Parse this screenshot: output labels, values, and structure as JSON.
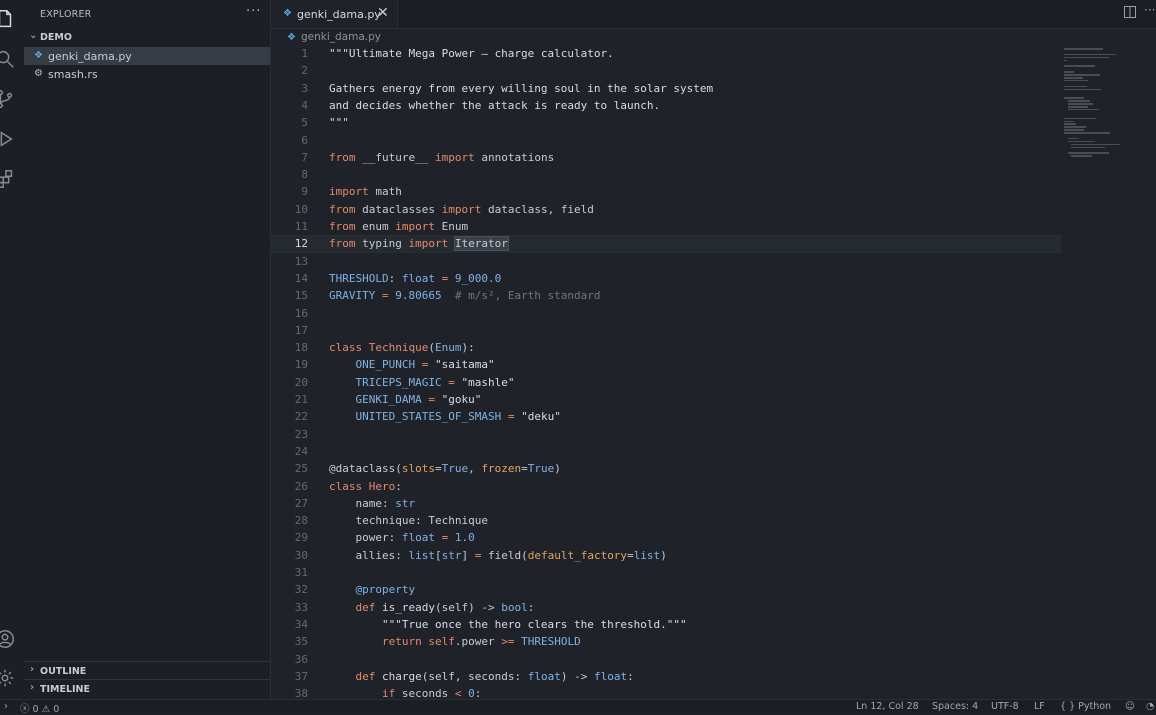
{
  "sidebar": {
    "title": "EXPLORER",
    "more": "···",
    "folder": "DEMO",
    "files": [
      {
        "name": "genki_dama.py",
        "icon": "python-file-icon"
      },
      {
        "name": "smash.rs",
        "icon": "rust-file-icon"
      }
    ],
    "outline": "OUTLINE",
    "timeline": "TIMELINE"
  },
  "tab": {
    "name": "genki_dama.py",
    "close": "✕"
  },
  "tabbar_more": "···",
  "breadcrumb": "genki_dama.py",
  "editor": {
    "current_line": 12,
    "lines": [
      [
        {
          "t": "\"\"\"Ultimate Mega Power — charge calculator.",
          "c": "str"
        }
      ],
      [],
      [
        {
          "t": "Gathers energy from every willing soul in the solar system",
          "c": "str"
        }
      ],
      [
        {
          "t": "and decides whether the attack is ready to launch.",
          "c": "str"
        }
      ],
      [
        {
          "t": "\"\"\"",
          "c": "str"
        }
      ],
      [],
      [
        {
          "t": "from",
          "c": "kw"
        },
        {
          "t": " __future__ "
        },
        {
          "t": "import",
          "c": "kw"
        },
        {
          "t": " annotations"
        }
      ],
      [],
      [
        {
          "t": "import",
          "c": "kw"
        },
        {
          "t": " math"
        }
      ],
      [
        {
          "t": "from",
          "c": "kw"
        },
        {
          "t": " dataclasses "
        },
        {
          "t": "import",
          "c": "kw"
        },
        {
          "t": " dataclass, field"
        }
      ],
      [
        {
          "t": "from",
          "c": "kw"
        },
        {
          "t": " enum "
        },
        {
          "t": "import",
          "c": "kw"
        },
        {
          "t": " Enum"
        }
      ],
      [
        {
          "t": "from",
          "c": "kw"
        },
        {
          "t": " typing "
        },
        {
          "t": "import",
          "c": "kw"
        },
        {
          "t": " "
        },
        {
          "t": "Iterator",
          "c": "sel"
        }
      ],
      [],
      [
        {
          "t": "THRESHOLD",
          "c": "const"
        },
        {
          "t": ": "
        },
        {
          "t": "float",
          "c": "type"
        },
        {
          "t": " "
        },
        {
          "t": "=",
          "c": "kw"
        },
        {
          "t": " "
        },
        {
          "t": "9_000.0",
          "c": "const"
        }
      ],
      [
        {
          "t": "GRAVITY",
          "c": "const"
        },
        {
          "t": " "
        },
        {
          "t": "=",
          "c": "kw"
        },
        {
          "t": " "
        },
        {
          "t": "9.80665",
          "c": "const"
        },
        {
          "t": "  # m/s², Earth standard",
          "c": "cmt"
        }
      ],
      [],
      [],
      [
        {
          "t": "class",
          "c": "kw"
        },
        {
          "t": " "
        },
        {
          "t": "Technique",
          "c": "cls"
        },
        {
          "t": "("
        },
        {
          "t": "Enum",
          "c": "type"
        },
        {
          "t": "):"
        }
      ],
      [
        {
          "t": "    "
        },
        {
          "t": "ONE_PUNCH",
          "c": "const"
        },
        {
          "t": " "
        },
        {
          "t": "=",
          "c": "kw"
        },
        {
          "t": " \"saitama\"",
          "c": "str"
        }
      ],
      [
        {
          "t": "    "
        },
        {
          "t": "TRICEPS_MAGIC",
          "c": "const"
        },
        {
          "t": " "
        },
        {
          "t": "=",
          "c": "kw"
        },
        {
          "t": " \"mashle\"",
          "c": "str"
        }
      ],
      [
        {
          "t": "    "
        },
        {
          "t": "GENKI_DAMA",
          "c": "const"
        },
        {
          "t": " "
        },
        {
          "t": "=",
          "c": "kw"
        },
        {
          "t": " \"goku\"",
          "c": "str"
        }
      ],
      [
        {
          "t": "    "
        },
        {
          "t": "UNITED_STATES_OF_SMASH",
          "c": "const"
        },
        {
          "t": " "
        },
        {
          "t": "=",
          "c": "kw"
        },
        {
          "t": " \"deku\"",
          "c": "str"
        }
      ],
      [],
      [],
      [
        {
          "t": "@dataclass",
          "c": "dec"
        },
        {
          "t": "("
        },
        {
          "t": "slots",
          "c": "param"
        },
        {
          "t": "="
        },
        {
          "t": "True",
          "c": "const"
        },
        {
          "t": ", "
        },
        {
          "t": "frozen",
          "c": "param"
        },
        {
          "t": "="
        },
        {
          "t": "True",
          "c": "const"
        },
        {
          "t": ")"
        }
      ],
      [
        {
          "t": "class",
          "c": "kw"
        },
        {
          "t": " "
        },
        {
          "t": "Hero",
          "c": "cls"
        },
        {
          "t": ":"
        }
      ],
      [
        {
          "t": "    name: "
        },
        {
          "t": "str",
          "c": "type"
        }
      ],
      [
        {
          "t": "    technique: Technique"
        }
      ],
      [
        {
          "t": "    power: "
        },
        {
          "t": "float",
          "c": "type"
        },
        {
          "t": " "
        },
        {
          "t": "=",
          "c": "kw"
        },
        {
          "t": " "
        },
        {
          "t": "1.0",
          "c": "const"
        }
      ],
      [
        {
          "t": "    allies: "
        },
        {
          "t": "list",
          "c": "type"
        },
        {
          "t": "["
        },
        {
          "t": "str",
          "c": "type"
        },
        {
          "t": "] "
        },
        {
          "t": "=",
          "c": "kw"
        },
        {
          "t": " field("
        },
        {
          "t": "default_factory",
          "c": "param"
        },
        {
          "t": "="
        },
        {
          "t": "list",
          "c": "type"
        },
        {
          "t": ")"
        }
      ],
      [],
      [
        {
          "t": "    "
        },
        {
          "t": "@property",
          "c": "const"
        }
      ],
      [
        {
          "t": "    "
        },
        {
          "t": "def",
          "c": "kw"
        },
        {
          "t": " "
        },
        {
          "t": "is_ready",
          "c": "fn"
        },
        {
          "t": "(self) -> "
        },
        {
          "t": "bool",
          "c": "type"
        },
        {
          "t": ":"
        }
      ],
      [
        {
          "t": "        "
        },
        {
          "t": "\"\"\"True once the hero clears the threshold.\"\"\"",
          "c": "str"
        }
      ],
      [
        {
          "t": "        "
        },
        {
          "t": "return",
          "c": "kw"
        },
        {
          "t": " "
        },
        {
          "t": "self",
          "c": "kw"
        },
        {
          "t": ".power "
        },
        {
          "t": ">=",
          "c": "kw"
        },
        {
          "t": " "
        },
        {
          "t": "THRESHOLD",
          "c": "const"
        }
      ],
      [],
      [
        {
          "t": "    "
        },
        {
          "t": "def",
          "c": "kw"
        },
        {
          "t": " "
        },
        {
          "t": "charge",
          "c": "fn"
        },
        {
          "t": "(self, seconds: "
        },
        {
          "t": "float",
          "c": "type"
        },
        {
          "t": ") -> "
        },
        {
          "t": "float",
          "c": "type"
        },
        {
          "t": ":"
        }
      ],
      [
        {
          "t": "        "
        },
        {
          "t": "if",
          "c": "kw"
        },
        {
          "t": " seconds "
        },
        {
          "t": "<",
          "c": "kw"
        },
        {
          "t": " "
        },
        {
          "t": "0",
          "c": "const"
        },
        {
          "t": ":"
        }
      ]
    ]
  },
  "status": {
    "errors": "0",
    "warnings": "0",
    "position": "Ln 12, Col 28",
    "spaces": "Spaces: 4",
    "encoding": "UTF-8",
    "eol": "LF",
    "language_icon": "{ }",
    "language": "Python"
  }
}
